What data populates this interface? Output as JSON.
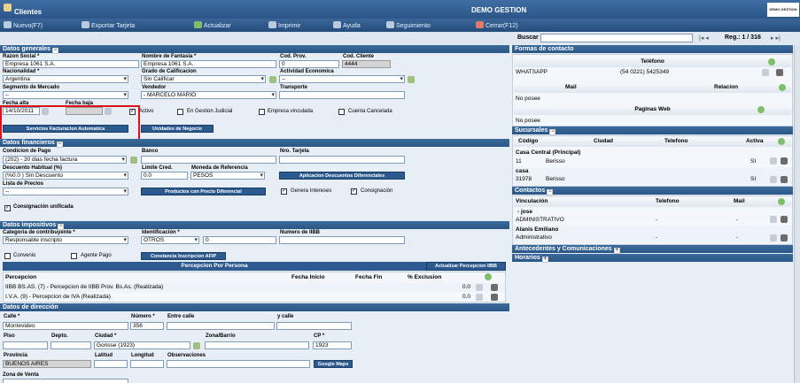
{
  "window": {
    "title": "Clientes",
    "app_name": "DEMO GESTION",
    "logo_text": "DEMO GESTION"
  },
  "toolbar": {
    "nuevo": "Nuevo(F7)",
    "exportar": "Exportar Tarjeta",
    "actualizar": "Actualizar",
    "imprimir": "Imprimir",
    "ayuda": "Ayuda",
    "seguimiento": "Seguimiento",
    "cerrar": "Cerrar(F12)"
  },
  "search": {
    "label": "Buscar",
    "value": "",
    "nav": "|◂  ◂",
    "reg": "Reg.: 1 / 316",
    "nav_next": "▸  ▸|"
  },
  "generales": {
    "title": "Datos generales",
    "razon_label": "Razon Social *",
    "razon": "Empresa 1061 S.A.",
    "fantasia_label": "Nombre de Fantasia *",
    "fantasia": "Empresa 1061 S.A.",
    "codprov_label": "Cod. Prov.",
    "codprov": "0",
    "codcli_label": "Cod. Cliente",
    "codcli": "4444",
    "nacionalidad_label": "Nacionalidad *",
    "nacionalidad": "Argentina",
    "grado_label": "Grado de Calificacion",
    "grado": "Sin Calificar",
    "actividad_label": "Actividad Economica",
    "actividad": "--",
    "segmento_label": "Segmento de Mercado",
    "segmento": "--",
    "vendedor_label": "Vendedor",
    "vendedor": "- MARCELO MARIO",
    "transporte_label": "Transporte",
    "transporte": "",
    "fechaalta_label": "Fecha alta",
    "fechaalta": "14/10/2011",
    "fechabaja_label": "Fecha baja",
    "fechabaja": "",
    "activo": "Activo",
    "gestion": "En Gestion Judicial",
    "vinculada": "Empresa vinculada",
    "cancelada": "Cuenta Cancelada",
    "btn_servicios": "Servicios Facturacion Automatica",
    "btn_unidades": "Unidades de Negocio"
  },
  "financieros": {
    "title": "Datos financieros",
    "condicion_label": "Condicion de Pago",
    "condicion": "(202) - 30 dias fecha factura",
    "banco_label": "Banco",
    "banco": "",
    "tarjeta_label": "Nro. Tarjeta",
    "tarjeta": "",
    "descuento_label": "Descuento Habitual (%)",
    "descuento": "(%0.0 ) Sin Descuento",
    "limite_label": "Limite Cred.",
    "limite": "0.0",
    "moneda_label": "Moneda de Referencia",
    "moneda": "PESOS",
    "btn_aplicacion": "Aplicacion Descuentos Diferenciales",
    "lista_label": "Lista de Precios",
    "lista": "--",
    "btn_productos": "Productos con Precio Diferencial",
    "genera": "Genera Intereses",
    "consignacion": "Consignación",
    "consig_unif": "Consignación unificada"
  },
  "impositivos": {
    "title": "Datos impositivos",
    "categoria_label": "Categoria de contribuyente *",
    "categoria": "Responsable inscripto",
    "identificacion_label": "Identificación *",
    "ident_tipo": "OTROS",
    "ident_num": "0",
    "iibb_label": "Numero de IIBB",
    "iibb": "",
    "convenio": "Convenio",
    "agente": "Agente Pago",
    "btn_afip": "Constancia Inscripcion AFIP"
  },
  "percepcion": {
    "title": "Percepcion Por Persona",
    "btn_actualizar": "Actualizar Percepcion IIBB",
    "cols": [
      "Percepcion",
      "Fecha Inicio",
      "Fecha Fin",
      "% Exclusion"
    ],
    "rows": [
      {
        "name": "IIBB BS.AS. (7) - Percepcion de IIBB Prov. Bs.As. (Realizada)",
        "excl": "0.0"
      },
      {
        "name": "I.V.A. (9) - Percepcion de IVA (Realizada)",
        "excl": "0.0"
      }
    ]
  },
  "direccion": {
    "title": "Datos de dirección",
    "calle_label": "Calle *",
    "calle": "Montevideo",
    "numero_label": "Número *",
    "numero": "356",
    "entre_label": "Entre calle",
    "ycalle_label": "y calle",
    "piso_label": "Piso",
    "depto_label": "Depto.",
    "ciudad_label": "Ciudad *",
    "ciudad": "Gonsse (1923)",
    "zona_label": "Zona/Barrio",
    "cp_label": "CP *",
    "cp": "1923",
    "provincia_label": "Provincia",
    "provincia": "BUENOS AIRES",
    "latitud_label": "Latitud",
    "longitud_label": "Longitud",
    "obs_label": "Observaciones",
    "btn_maps": "Google Maps",
    "zonaventa_label": "Zona de Venta"
  },
  "contacto": {
    "title": "Formas de contacto",
    "telefono_hdr": "Teléfono",
    "whatsapp": "WHATSAPP",
    "whatsapp_num": "(54 0221) 5425349",
    "mail_hdr": "Mail",
    "relacion_hdr": "Relacion",
    "mail_none": "No posee",
    "web_hdr": "Paginas Web",
    "web_none": "No posee"
  },
  "sucursales": {
    "title": "Sucursales",
    "cols": [
      "Código",
      "Ciudad",
      "Telefono",
      "Activa"
    ],
    "rows": [
      {
        "name": "Casa Central (Principal)",
        "code": "11",
        "city": "Berisso",
        "active": "SI"
      },
      {
        "name": "casa",
        "code": "31978",
        "city": "Berisso",
        "active": "SI"
      }
    ]
  },
  "contactos": {
    "title": "Contactos",
    "cols": [
      "Vinculación",
      "Telefono",
      "Mail"
    ],
    "rows": [
      {
        "name": "- jose",
        "role": "ADMINISTRATIVO",
        "tel": "-",
        "mail": "-"
      },
      {
        "name": "Alanis Emiliano",
        "role": "Administrativo",
        "tel": "-",
        "mail": "-"
      }
    ]
  },
  "antecedentes": {
    "title": "Antecedentes y Comunicaciones"
  },
  "horarios": {
    "title": "Horarios"
  },
  "colors": {
    "header": "#2c5689",
    "section": "#2e5a8a",
    "highlight": "#e0101a",
    "background": "#e8eef5"
  }
}
